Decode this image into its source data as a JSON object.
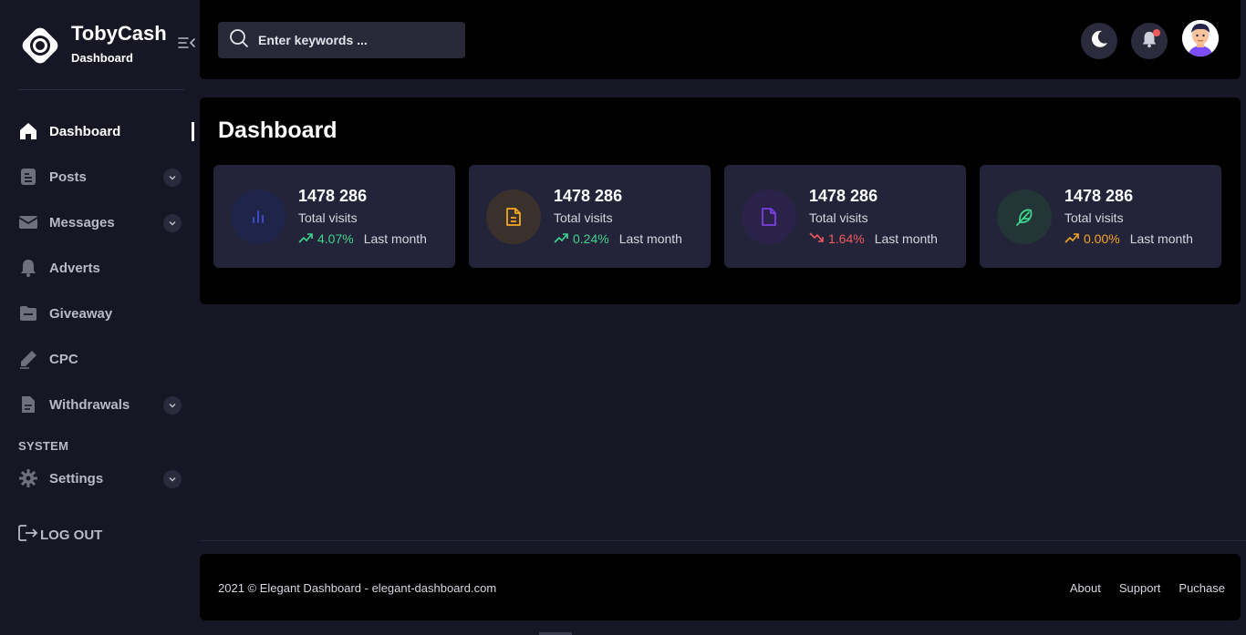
{
  "brand": {
    "name": "TobyCash",
    "subtitle": "Dashboard"
  },
  "sidebar": {
    "items": [
      {
        "label": "Dashboard",
        "icon": "home-icon",
        "active": true,
        "has_submenu": false
      },
      {
        "label": "Posts",
        "icon": "posts-icon",
        "active": false,
        "has_submenu": true
      },
      {
        "label": "Messages",
        "icon": "envelope-icon",
        "active": false,
        "has_submenu": true
      },
      {
        "label": "Adverts",
        "icon": "bell-icon",
        "active": false,
        "has_submenu": false
      },
      {
        "label": "Giveaway",
        "icon": "folder-icon",
        "active": false,
        "has_submenu": false
      },
      {
        "label": "CPC",
        "icon": "pencil-icon",
        "active": false,
        "has_submenu": false
      },
      {
        "label": "Withdrawals",
        "icon": "document-icon",
        "active": false,
        "has_submenu": true
      }
    ],
    "section_title": "SYSTEM",
    "system_items": [
      {
        "label": "Settings",
        "icon": "gear-icon",
        "has_submenu": true
      }
    ],
    "logout_label": "LOG OUT"
  },
  "header": {
    "search_placeholder": "Enter keywords ...",
    "notification_dot_color": "#f05b5b"
  },
  "main": {
    "title": "Dashboard",
    "cards": [
      {
        "value": "1478 286",
        "label": "Total visits",
        "trend": "4.07%",
        "trend_direction": "up",
        "trend_color": "#3dd68c",
        "period": "Last month",
        "icon": "bar-chart-icon",
        "icon_color": "#3d52d5",
        "icon_bg": "#1f2548"
      },
      {
        "value": "1478 286",
        "label": "Total visits",
        "trend": "0.24%",
        "trend_direction": "up",
        "trend_color": "#3dd68c",
        "period": "Last month",
        "icon": "file-icon",
        "icon_color": "#f5a623",
        "icon_bg": "#3a302c"
      },
      {
        "value": "1478 286",
        "label": "Total visits",
        "trend": "1.64%",
        "trend_direction": "down",
        "trend_color": "#f05b5b",
        "period": "Last month",
        "icon": "file-icon",
        "icon_color": "#7b3fe4",
        "icon_bg": "#2a2249"
      },
      {
        "value": "1478 286",
        "label": "Total visits",
        "trend": "0.00%",
        "trend_direction": "up",
        "trend_color": "#f5a623",
        "period": "Last month",
        "icon": "feather-icon",
        "icon_color": "#3dd68c",
        "icon_bg": "#233536"
      }
    ]
  },
  "footer": {
    "copyright": "2021 © Elegant Dashboard - elegant-dashboard.com",
    "links": [
      "About",
      "Support",
      "Puchase"
    ]
  }
}
